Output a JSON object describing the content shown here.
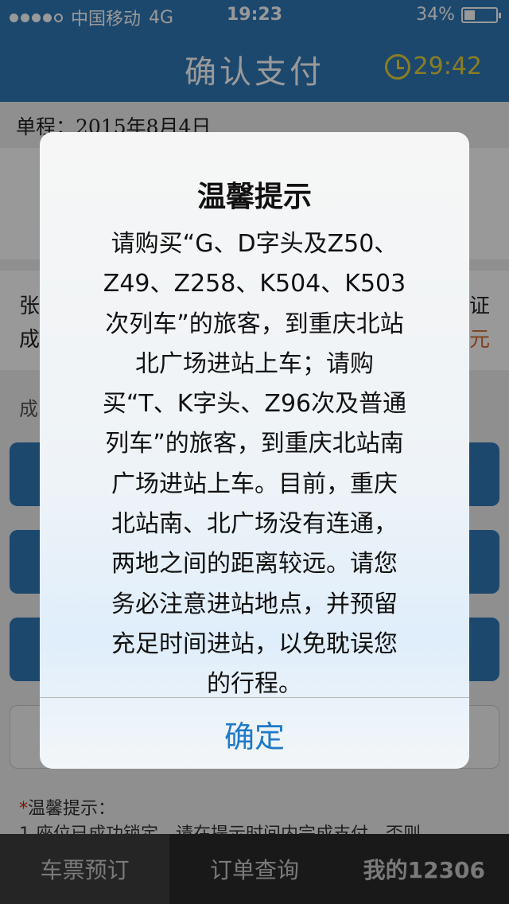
{
  "status_bar": {
    "carrier": "中国移动",
    "network": "4G",
    "time": "19:23",
    "battery": "34%",
    "battery_level": 0.34
  },
  "header": {
    "title": "确认支付",
    "countdown": "29:42",
    "countdown_color": "#e6d23a"
  },
  "trip": {
    "label": "单程：2015年8月4日"
  },
  "passenger_peek": {
    "left_1": "张",
    "left_2": "成",
    "right_1": "证",
    "right_2": "元"
  },
  "section_label_peek": "成",
  "tips": {
    "title": "温馨提示：",
    "line_1": "1.座位已成功锁定，请在提示时间内完成支付，否则"
  },
  "dialog": {
    "title": "温馨提示",
    "message_lines": [
      "请购买“G、D字头及Z50、",
      "Z49、Z258、K504、K503",
      "次列车”的旅客，到重庆北站",
      "北广场进站上车；请购",
      "买“T、K字头、Z96次及普通",
      "列车”的旅客，到重庆北站南",
      "广场进站上车。目前，重庆",
      "北站南、北广场没有连通，",
      "两地之间的距离较远。请您",
      "务必注意进站地点，并预留",
      "充足时间进站，以免耽误您",
      "的行程。"
    ],
    "confirm": "确定"
  },
  "tabbar": {
    "items": [
      {
        "label": "车票预订"
      },
      {
        "label": "订单查询"
      },
      {
        "label": "我的12306"
      }
    ]
  },
  "colors": {
    "brand_blue": "#2f78b8",
    "link_blue": "#1f7ac7",
    "required_red": "#d31c1c"
  }
}
